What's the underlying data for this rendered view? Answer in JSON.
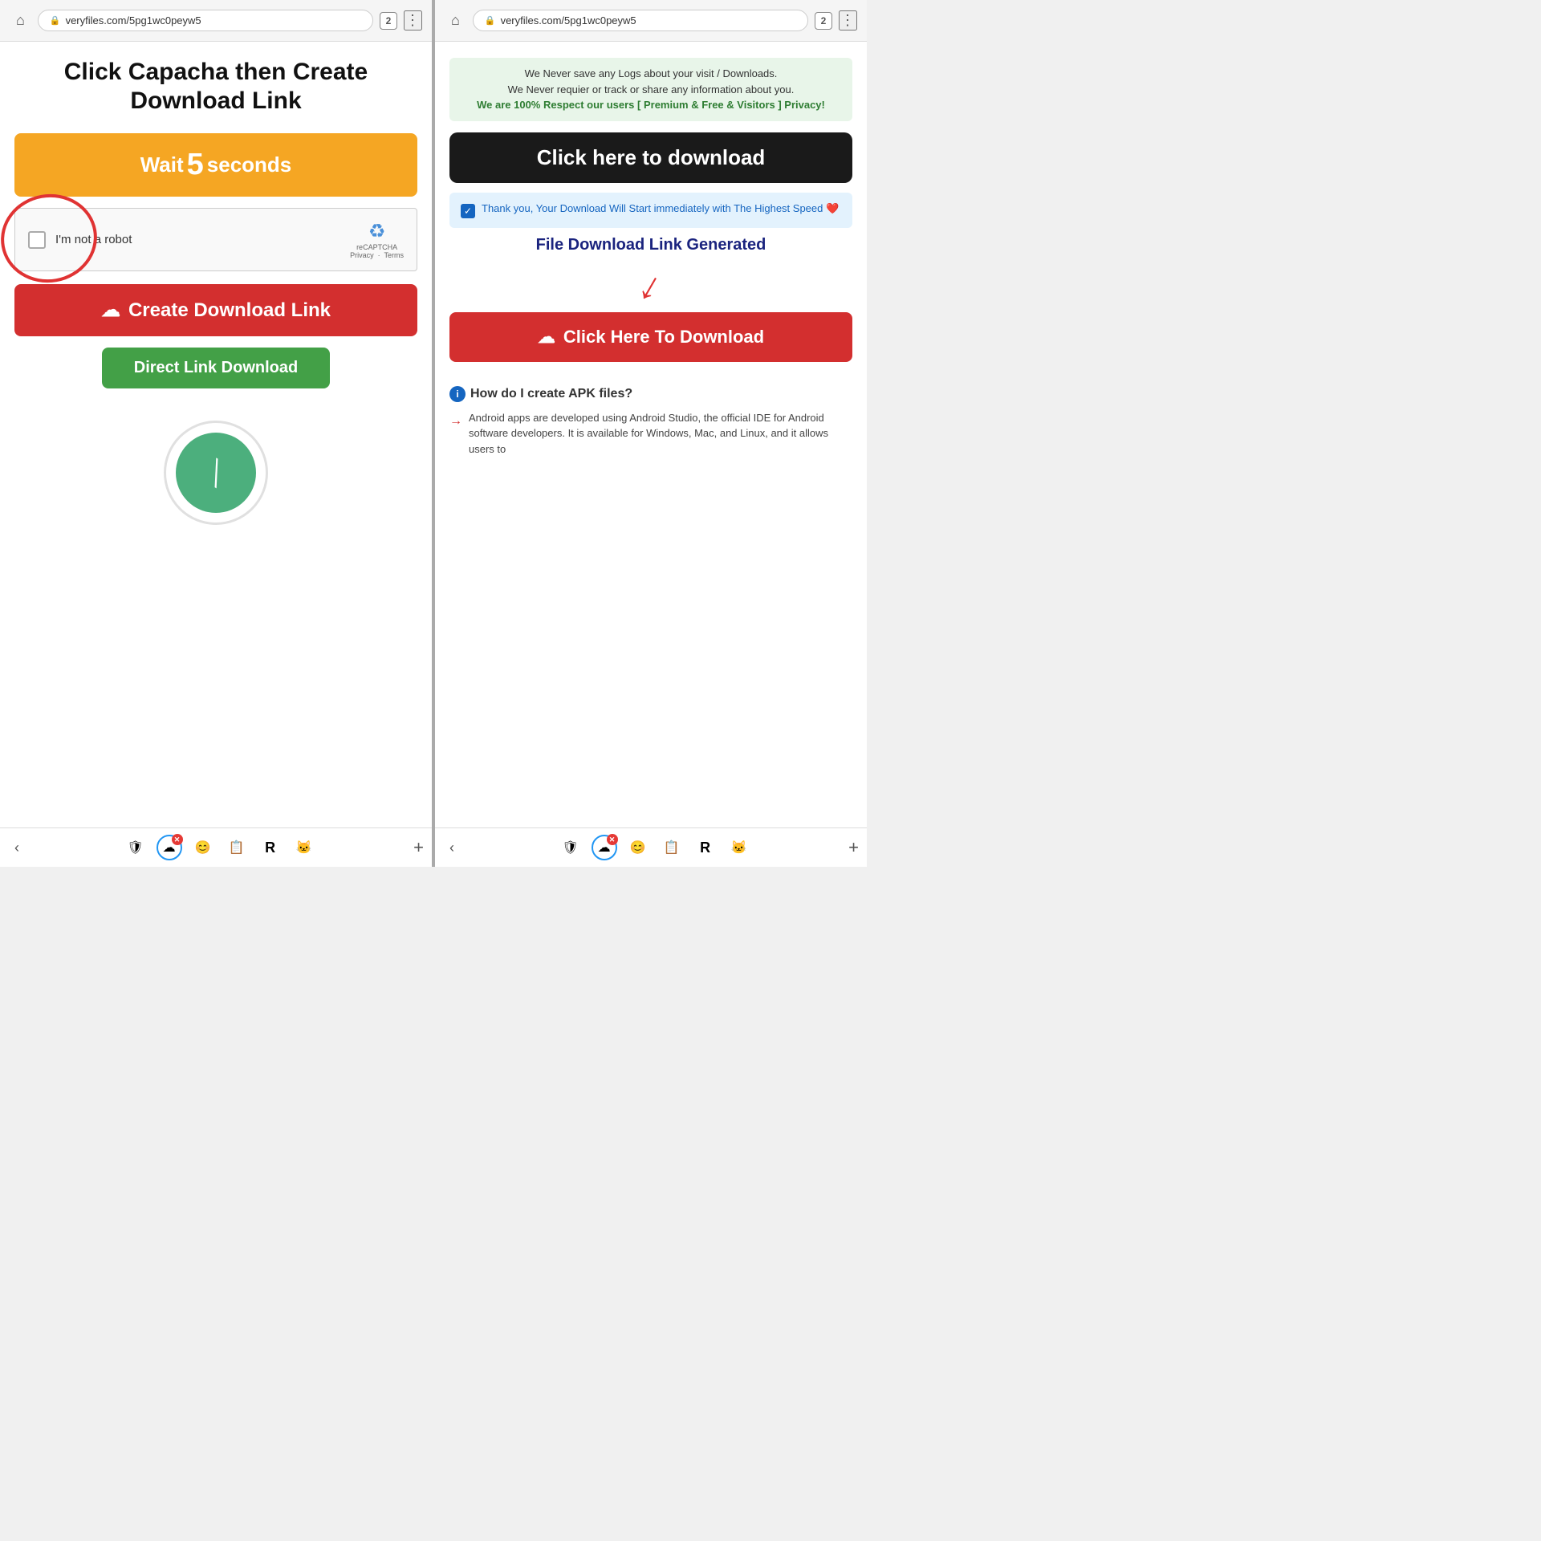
{
  "left_screen": {
    "browser": {
      "url": "veryfiles.com/5pg1wc0peyw5",
      "tab_count": "2"
    },
    "heading": "Click Capacha then Create Download Link",
    "wait_button": {
      "label_before": "Wait",
      "number": "5",
      "label_after": "seconds"
    },
    "recaptcha": {
      "label": "I'm not a robot",
      "recaptcha_text": "reCAPTCHA",
      "privacy": "Privacy",
      "terms": "Terms"
    },
    "create_button": {
      "label": "Create Download Link",
      "icon": "☁"
    },
    "direct_link_button": {
      "label": "Direct Link Download"
    }
  },
  "right_screen": {
    "browser": {
      "url": "veryfiles.com/5pg1wc0peyw5",
      "tab_count": "2"
    },
    "privacy_notice": {
      "line1": "We Never save any Logs about your visit / Downloads.",
      "line2": "We Never requier or track or share any information about you.",
      "line3": "We are 100% Respect our users [ Premium & Free & Visitors ] Privacy!"
    },
    "tooltip": {
      "label": "Click here to download"
    },
    "confirmation": {
      "text": "Thank you, Your Download Will Start immediately with The Highest Speed ❤️"
    },
    "generated_text": "File Download Link Generated",
    "click_download_button": {
      "label": "Click Here To Download",
      "icon": "☁"
    },
    "how_to_section": {
      "title": "How do I create APK files?",
      "items": [
        "Android apps are developed using Android Studio, the official IDE for Android software developers. It is available for Windows, Mac, and Linux, and it allows users to"
      ]
    }
  },
  "bottom_nav": {
    "back_label": "‹",
    "tabs": [
      {
        "icon": "🛡",
        "active": false
      },
      {
        "icon": "☁",
        "active": true
      },
      {
        "icon": "😊",
        "active": false
      },
      {
        "icon": "📋",
        "active": false
      },
      {
        "icon": "R",
        "active": false
      },
      {
        "icon": "🐱",
        "active": false
      }
    ],
    "add_label": "+"
  }
}
